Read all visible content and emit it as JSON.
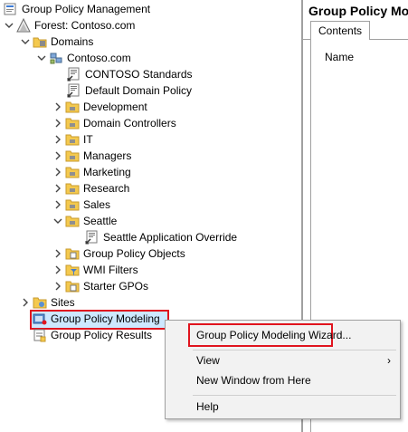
{
  "tree": {
    "root": "Group Policy Management",
    "forest": "Forest: Contoso.com",
    "domains": "Domains",
    "domain": "Contoso.com",
    "gpo_links": [
      "CONTOSO Standards",
      "Default Domain Policy"
    ],
    "ous": [
      "Development",
      "Domain Controllers",
      "IT",
      "Managers",
      "Marketing",
      "Research",
      "Sales"
    ],
    "seattle": "Seattle",
    "seattle_child": "Seattle Application Override",
    "group_policy_objects": "Group Policy Objects",
    "wmi_filters": "WMI Filters",
    "starter_gpos": "Starter GPOs",
    "sites": "Sites",
    "modeling": "Group Policy Modeling",
    "results": "Group Policy Results"
  },
  "right_pane": {
    "title": "Group Policy Mo",
    "tab": "Contents",
    "column": "Name"
  },
  "context_menu": {
    "wizard": "Group Policy Modeling Wizard...",
    "view": "View",
    "new_window": "New Window from Here",
    "help": "Help",
    "submenu_arrow": "›"
  },
  "colors": {
    "highlight_outline": "#e0141e",
    "selection": "#cde8ff"
  }
}
